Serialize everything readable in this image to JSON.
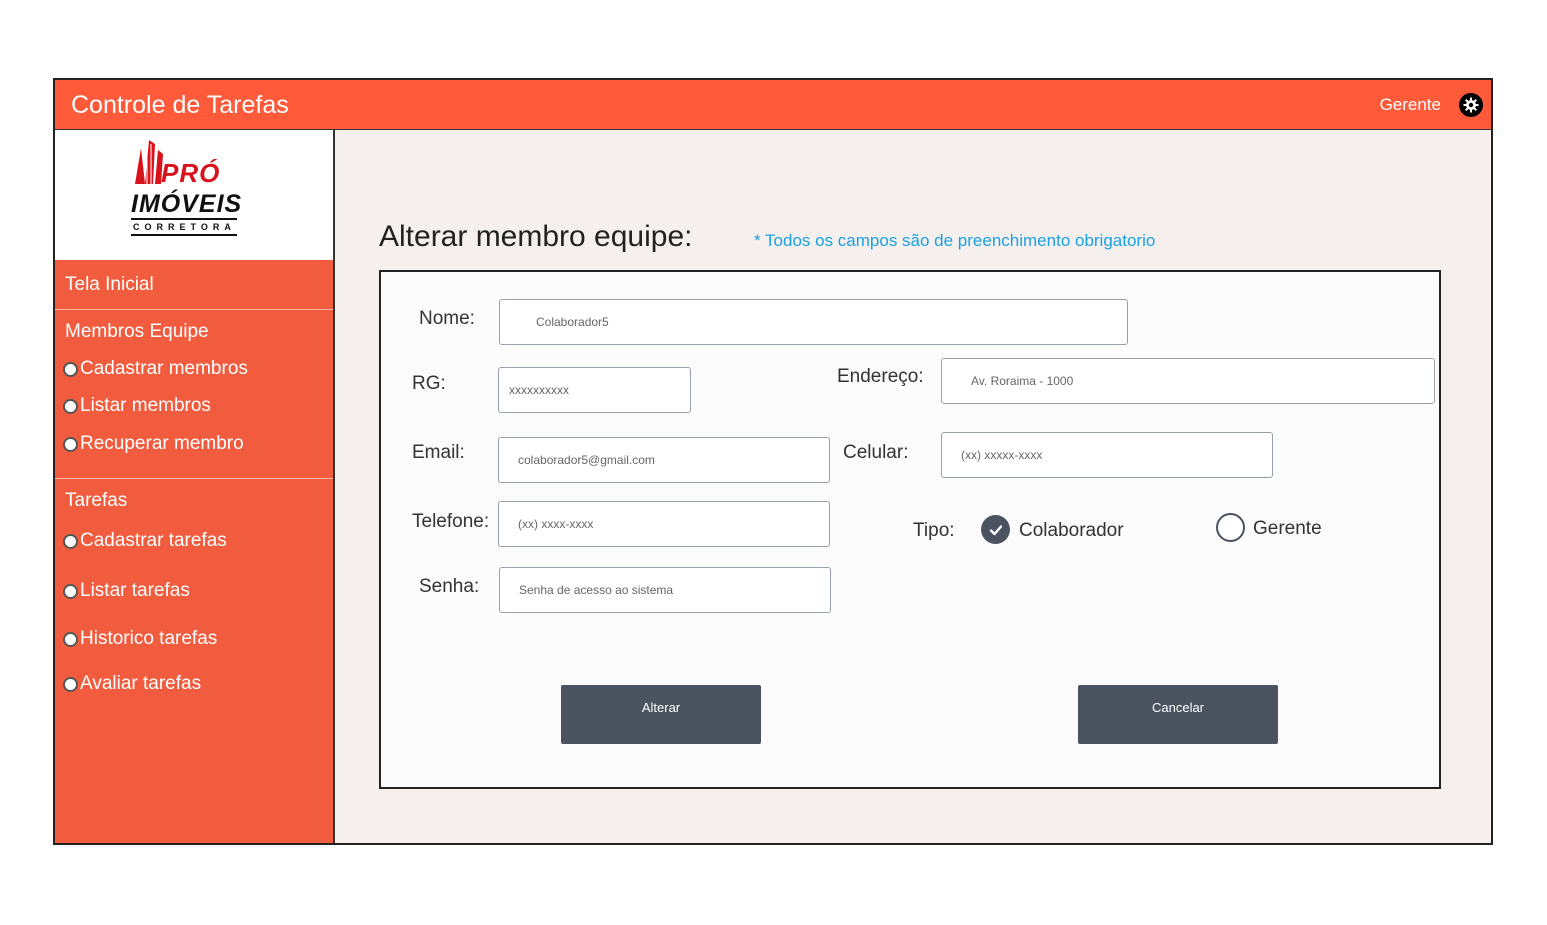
{
  "header": {
    "title": "Controle de Tarefas",
    "user_label": "Gerente"
  },
  "logo": {
    "line1": "PRÓ",
    "line2": "IMÓVEIS",
    "line3": "CORRETORA"
  },
  "sidebar": {
    "home": "Tela Inicial",
    "members_section": "Membros Equipe",
    "members_items": [
      "Cadastrar membros",
      "Listar membros",
      "Recuperar membro"
    ],
    "tasks_section": "Tarefas",
    "tasks_items": [
      "Cadastrar tarefas",
      "Listar tarefas",
      "Historico tarefas",
      "Avaliar tarefas"
    ]
  },
  "page": {
    "heading": "Alterar membro equipe:",
    "note": "* Todos os campos são de preenchimento obrigatorio"
  },
  "form": {
    "nome_label": "Nome:",
    "nome_value": "Colaborador5",
    "rg_label": "RG:",
    "rg_value": "xxxxxxxxxx",
    "endereco_label": "Endereço:",
    "endereco_value": "Av. Roraima - 1000",
    "email_label": "Email:",
    "email_value": "colaborador5@gmail.com",
    "celular_label": "Celular:",
    "celular_value": "(xx) xxxxx-xxxx",
    "telefone_label": "Telefone:",
    "telefone_value": "(xx) xxxx-xxxx",
    "tipo_label": "Tipo:",
    "tipo_options": [
      "Colaborador",
      "Gerente"
    ],
    "tipo_selected": "Colaborador",
    "senha_label": "Senha:",
    "senha_placeholder": "Senha de acesso ao sistema",
    "submit_label": "Alterar",
    "cancel_label": "Cancelar"
  },
  "colors": {
    "topbar": "#ff5a3a",
    "sidebar": "#f15c3f",
    "button": "#4a535f",
    "note": "#1ba1e2",
    "logo_red": "#d8131c"
  }
}
